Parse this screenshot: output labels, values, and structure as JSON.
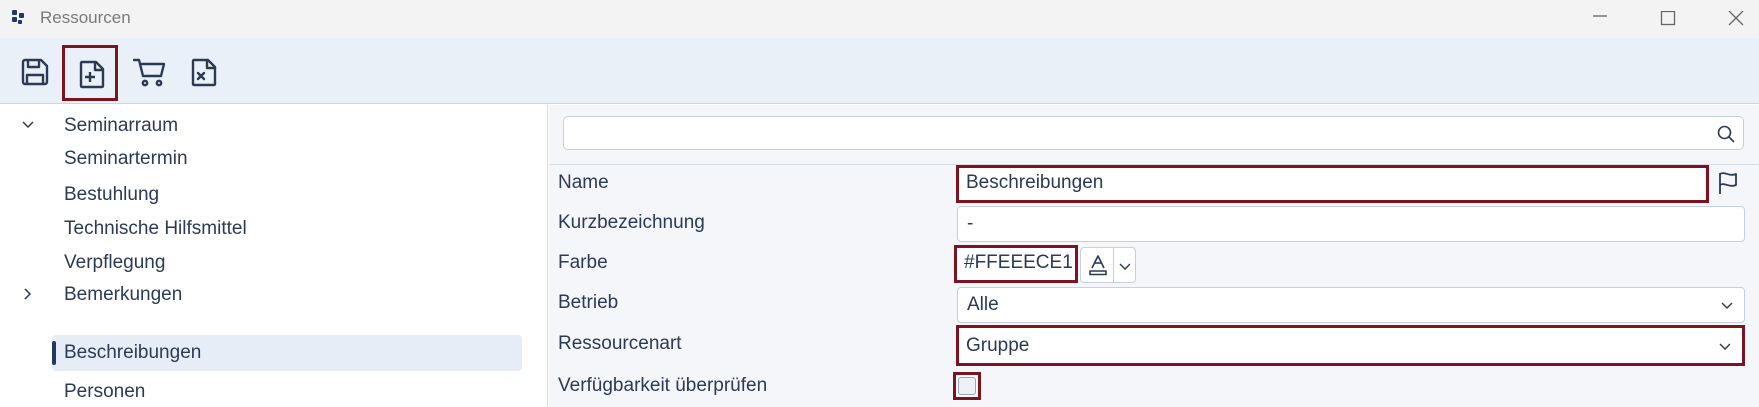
{
  "window": {
    "title": "Ressourcen"
  },
  "toolbar": {
    "buttons": [
      {
        "name": "save",
        "icon": "save-icon"
      },
      {
        "name": "new",
        "icon": "new-document-icon"
      },
      {
        "name": "cart",
        "icon": "cart-icon"
      },
      {
        "name": "discard",
        "icon": "discard-document-icon"
      }
    ]
  },
  "tree": {
    "items": [
      {
        "label": "Seminarraum",
        "expander": "expanded"
      },
      {
        "label": "Seminartermin"
      },
      {
        "label": "Bestuhlung"
      },
      {
        "label": "Technische Hilfsmittel"
      },
      {
        "label": "Verpflegung"
      },
      {
        "label": "Bemerkungen",
        "expander": "collapsed"
      },
      {
        "label": "Beschreibungen",
        "selected": true
      },
      {
        "label": "Personen"
      }
    ]
  },
  "form": {
    "search": {
      "value": "",
      "placeholder": ""
    },
    "fields": {
      "name": {
        "label": "Name",
        "value": "Beschreibungen"
      },
      "short": {
        "label": "Kurzbezeichnung",
        "value": "-"
      },
      "color": {
        "label": "Farbe",
        "value": "#FFEEECE1"
      },
      "operation": {
        "label": "Betrieb",
        "value": "Alle"
      },
      "resource_type": {
        "label": "Ressourcenart",
        "value": "Gruppe"
      },
      "availability": {
        "label": "Verfügbarkeit überprüfen",
        "checked": false
      }
    }
  },
  "colors": {
    "highlight": "#7b1321",
    "toolbar_bg": "#eaf0f8",
    "selected_bg": "#e6edf7",
    "text": "#2b3a55"
  }
}
